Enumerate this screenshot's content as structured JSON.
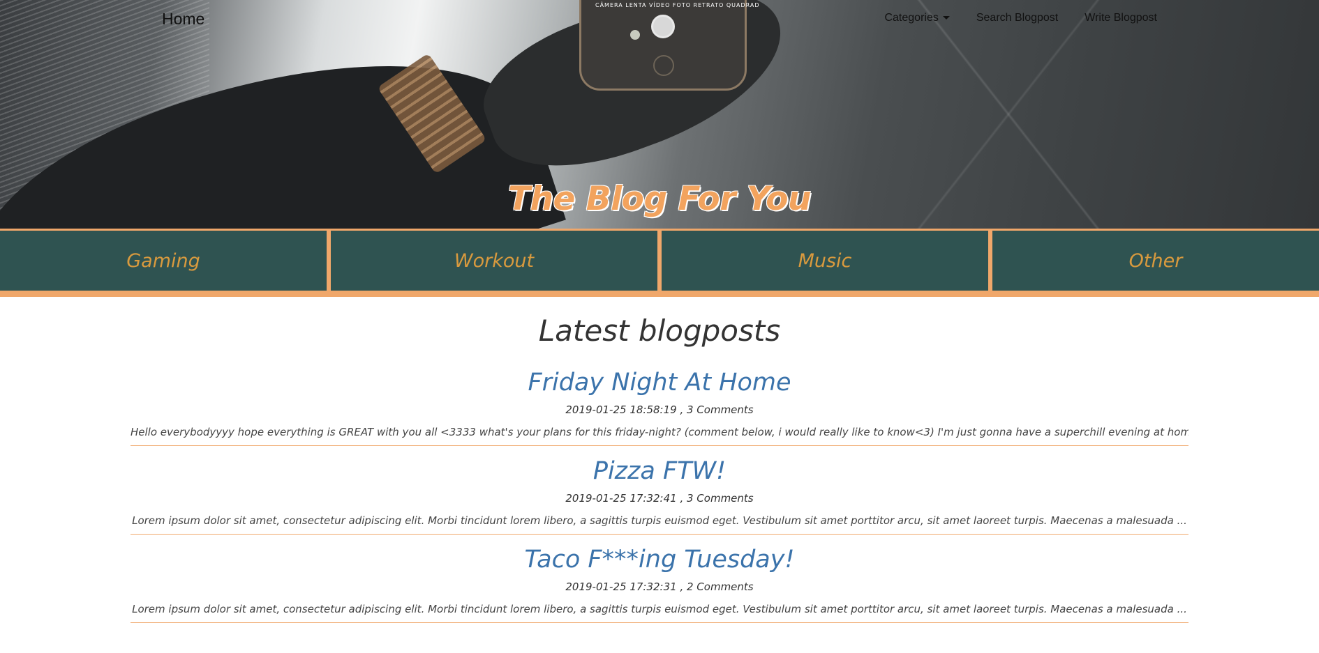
{
  "nav": {
    "home": "Home",
    "categories": "Categories",
    "search": "Search Blogpost",
    "write": "Write Blogpost"
  },
  "hero": {
    "title": "The Blog For You",
    "phone_modes": "CÂMERA LENTA   VÍDEO   FOTO   RETRATO   QUADRAD"
  },
  "categories": [
    "Gaming",
    "Workout",
    "Music",
    "Other"
  ],
  "main": {
    "heading": "Latest blogposts",
    "posts": [
      {
        "title": "Friday Night At Home",
        "meta": "2019-01-25 18:58:19 , 3 Comments",
        "excerpt": "Hello everybodyyyy hope everything is GREAT with you all <3333 what's your plans for this friday-night? (comment below, i would really like to know<3) I'm just gonna have a superchill evening at home ..."
      },
      {
        "title": "Pizza FTW!",
        "meta": "2019-01-25 17:32:41 , 3 Comments",
        "excerpt": "Lorem ipsum dolor sit amet, consectetur adipiscing elit. Morbi tincidunt lorem libero, a sagittis turpis euismod eget. Vestibulum sit amet porttitor arcu, sit amet laoreet turpis. Maecenas a malesuada ..."
      },
      {
        "title": "Taco F***ing Tuesday!",
        "meta": "2019-01-25 17:32:31 , 2 Comments",
        "excerpt": "Lorem ipsum dolor sit amet, consectetur adipiscing elit. Morbi tincidunt lorem libero, a sagittis turpis euismod eget. Vestibulum sit amet porttitor arcu, sit amet laoreet turpis. Maecenas a malesuada ..."
      }
    ]
  },
  "colors": {
    "accent": "#f0a76a",
    "category_bg": "#2f5351",
    "category_text": "#d99a3e",
    "link": "#3b73ab",
    "title_orange": "#f2a35e"
  },
  "icons": {
    "categories_dropdown": "caret-down-icon"
  }
}
